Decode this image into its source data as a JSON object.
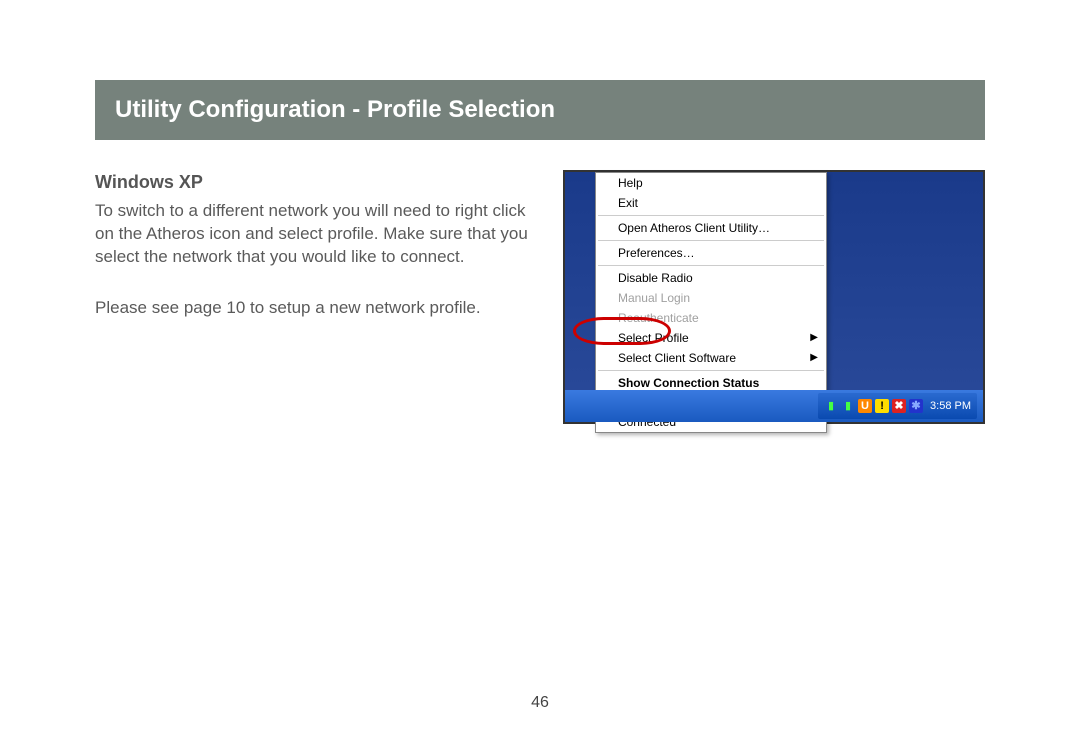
{
  "title": "Utility Configuration - Profile Selection",
  "os_heading": "Windows XP",
  "para1": "To switch to a different network you will need to right click on the Atheros icon and select profile. Make sure that you select the network that you would like to connect.",
  "para2": "Please see page 10 to setup a new network profile.",
  "menu": {
    "help": "Help",
    "exit": "Exit",
    "open_util": "Open Atheros Client Utility…",
    "prefs": "Preferences…",
    "disable_radio": "Disable Radio",
    "manual_login": "Manual Login",
    "reauth": "Reauthenticate",
    "select_profile": "Select Profile",
    "select_client": "Select Client Software",
    "show_status": "Show Connection Status",
    "disable_wlan": "Disable WLAN if LAN is Connected"
  },
  "tray": {
    "clock": "3:58 PM"
  },
  "page_number": "46"
}
